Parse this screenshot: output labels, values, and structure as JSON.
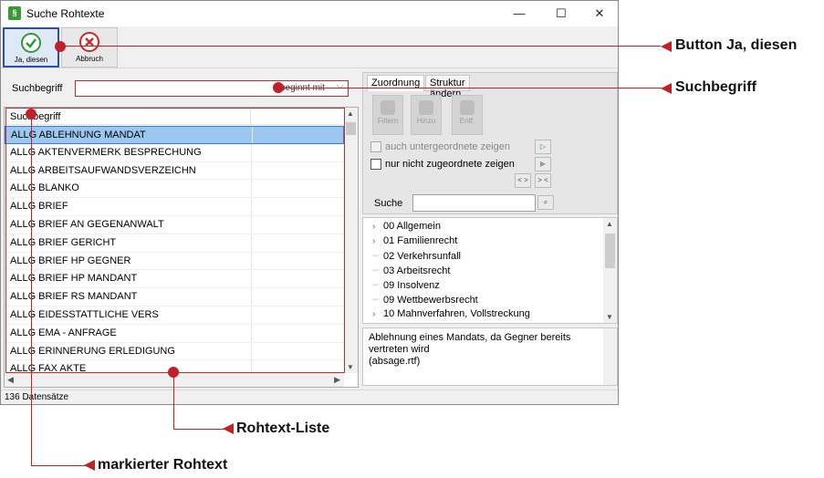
{
  "window": {
    "title": "Suche Rohtexte",
    "minimize": "—",
    "maximize": "☐",
    "close": "✕"
  },
  "toolbar": {
    "ja_label": "Ja, diesen",
    "abbruch_label": "Abbruch"
  },
  "search": {
    "label": "Suchbegriff",
    "value": "",
    "mode": "beginnt mit"
  },
  "list": {
    "header": "Suchbegriff",
    "rows": [
      "ALLG ABLEHNUNG MANDAT",
      "ALLG AKTENVERMERK BESPRECHUNG",
      "ALLG ARBEITSAUFWANDSVERZEICHN",
      "ALLG BLANKO",
      "ALLG BRIEF",
      "ALLG BRIEF AN GEGENANWALT",
      "ALLG BRIEF GERICHT",
      "ALLG BRIEF HP GEGNER",
      "ALLG BRIEF HP MANDANT",
      "ALLG BRIEF RS MANDANT",
      "ALLG EIDESSTATTLICHE VERS",
      "ALLG EMA - ANFRAGE",
      "ALLG ERINNERUNG ERLEDIGUNG",
      "ALLG FAX AKTE"
    ],
    "selected_index": 0
  },
  "status": {
    "count": "136 Datensätze"
  },
  "right": {
    "tabs": [
      "Zuordnung",
      "Struktur ändern"
    ],
    "buttons": [
      "Filtern",
      "Hinzu",
      "Entf."
    ],
    "check1": "auch untergeordnete zeigen",
    "check2": "nur nicht zugeordnete zeigen",
    "btn_expand": "< >",
    "btn_collapse": "> <",
    "suche_label": "Suche",
    "suche_value": ""
  },
  "tree": [
    {
      "label": "00 Allgemein",
      "expandable": true
    },
    {
      "label": "01 Familienrecht",
      "expandable": true
    },
    {
      "label": "02 Verkehrsunfall",
      "expandable": false
    },
    {
      "label": "03 Arbeitsrecht",
      "expandable": false
    },
    {
      "label": "09 Insolvenz",
      "expandable": false
    },
    {
      "label": "09 Wettbewerbsrecht",
      "expandable": false
    },
    {
      "label": "10 Mahnverfahren, Vollstreckung",
      "expandable": true
    }
  ],
  "description": {
    "line1": "Ablehnung eines Mandats, da Gegner bereits",
    "line2": "vertreten wird",
    "line3": "(absage.rtf)"
  },
  "annotations": {
    "ja": "Button Ja, diesen",
    "suchbegriff": "Suchbegriff",
    "liste": "Rohtext-Liste",
    "markiert": "markierter Rohtext"
  },
  "colors": {
    "annotation_red": "#c0202a",
    "selection_blue": "#9cc8f0",
    "ok_green": "#2e9a3a",
    "cancel_red": "#d02828"
  }
}
